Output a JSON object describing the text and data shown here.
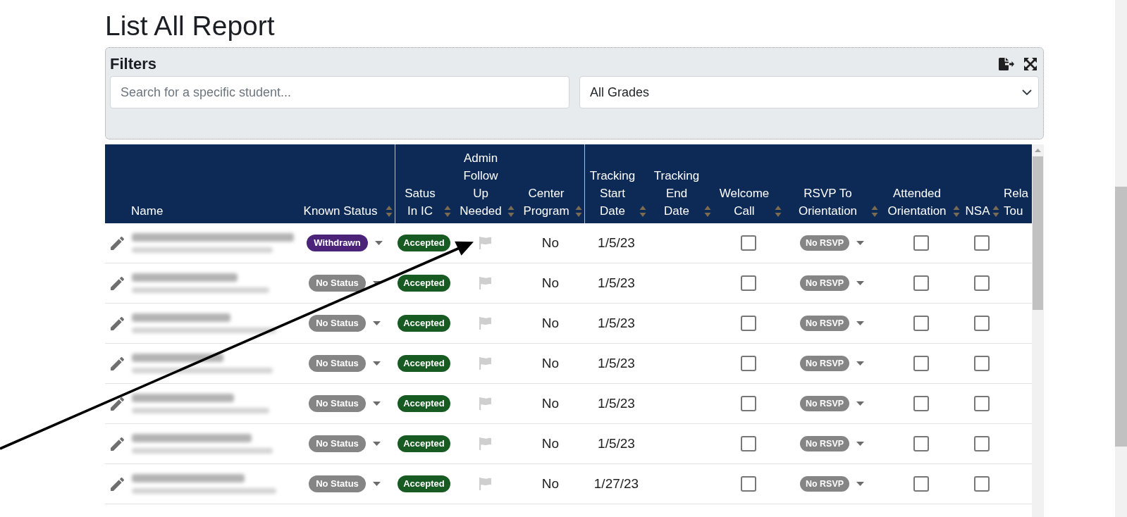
{
  "page": {
    "title": "List All Report"
  },
  "filters": {
    "title": "Filters",
    "search": {
      "placeholder": "Search for a specific student..."
    },
    "grade_select": {
      "value": "All Grades"
    }
  },
  "table": {
    "column_groups": [
      {
        "columns": [
          {
            "label": "Name",
            "sortable": false
          },
          {
            "label": "Known Status",
            "sortable": true
          }
        ]
      },
      {
        "columns": [
          {
            "label": "Satus In IC",
            "sortable": true
          },
          {
            "label": "Admin Follow Up Needed",
            "sortable": true
          },
          {
            "label": "Center Program",
            "sortable": true
          }
        ]
      },
      {
        "columns": [
          {
            "label": "Tracking Start Date",
            "sortable": true
          },
          {
            "label": "Tracking End Date",
            "sortable": true
          },
          {
            "label": "Welcome Call",
            "sortable": true
          },
          {
            "label": "RSVP To Orientation",
            "sortable": true
          },
          {
            "label": "Attended Orientation",
            "sortable": true
          },
          {
            "label": "NSA",
            "sortable": true
          },
          {
            "label": "Rela Tou",
            "sortable": false
          }
        ]
      }
    ],
    "rows": [
      {
        "known_status": {
          "label": "Withdrawn",
          "color": "#4b2479"
        },
        "ic_status": "Accepted",
        "follow_up_flagged": false,
        "center_program": "No",
        "tracking_start": "1/5/23",
        "welcome_call": false,
        "rsvp": "No RSVP",
        "attended_orientation": false,
        "nsa": false
      },
      {
        "known_status": {
          "label": "No Status",
          "color": "#858585"
        },
        "ic_status": "Accepted",
        "follow_up_flagged": false,
        "center_program": "No",
        "tracking_start": "1/5/23",
        "welcome_call": false,
        "rsvp": "No RSVP",
        "attended_orientation": false,
        "nsa": false
      },
      {
        "known_status": {
          "label": "No Status",
          "color": "#858585"
        },
        "ic_status": "Accepted",
        "follow_up_flagged": false,
        "center_program": "No",
        "tracking_start": "1/5/23",
        "welcome_call": false,
        "rsvp": "No RSVP",
        "attended_orientation": false,
        "nsa": false
      },
      {
        "known_status": {
          "label": "No Status",
          "color": "#858585"
        },
        "ic_status": "Accepted",
        "follow_up_flagged": false,
        "center_program": "No",
        "tracking_start": "1/5/23",
        "welcome_call": false,
        "rsvp": "No RSVP",
        "attended_orientation": false,
        "nsa": false
      },
      {
        "known_status": {
          "label": "No Status",
          "color": "#858585"
        },
        "ic_status": "Accepted",
        "follow_up_flagged": false,
        "center_program": "No",
        "tracking_start": "1/5/23",
        "welcome_call": false,
        "rsvp": "No RSVP",
        "attended_orientation": false,
        "nsa": false
      },
      {
        "known_status": {
          "label": "No Status",
          "color": "#858585"
        },
        "ic_status": "Accepted",
        "follow_up_flagged": false,
        "center_program": "No",
        "tracking_start": "1/5/23",
        "welcome_call": false,
        "rsvp": "No RSVP",
        "attended_orientation": false,
        "nsa": false
      },
      {
        "known_status": {
          "label": "No Status",
          "color": "#858585"
        },
        "ic_status": "Accepted",
        "follow_up_flagged": false,
        "center_program": "No",
        "tracking_start": "1/27/23",
        "welcome_call": false,
        "rsvp": "No RSVP",
        "attended_orientation": false,
        "nsa": false
      }
    ]
  }
}
